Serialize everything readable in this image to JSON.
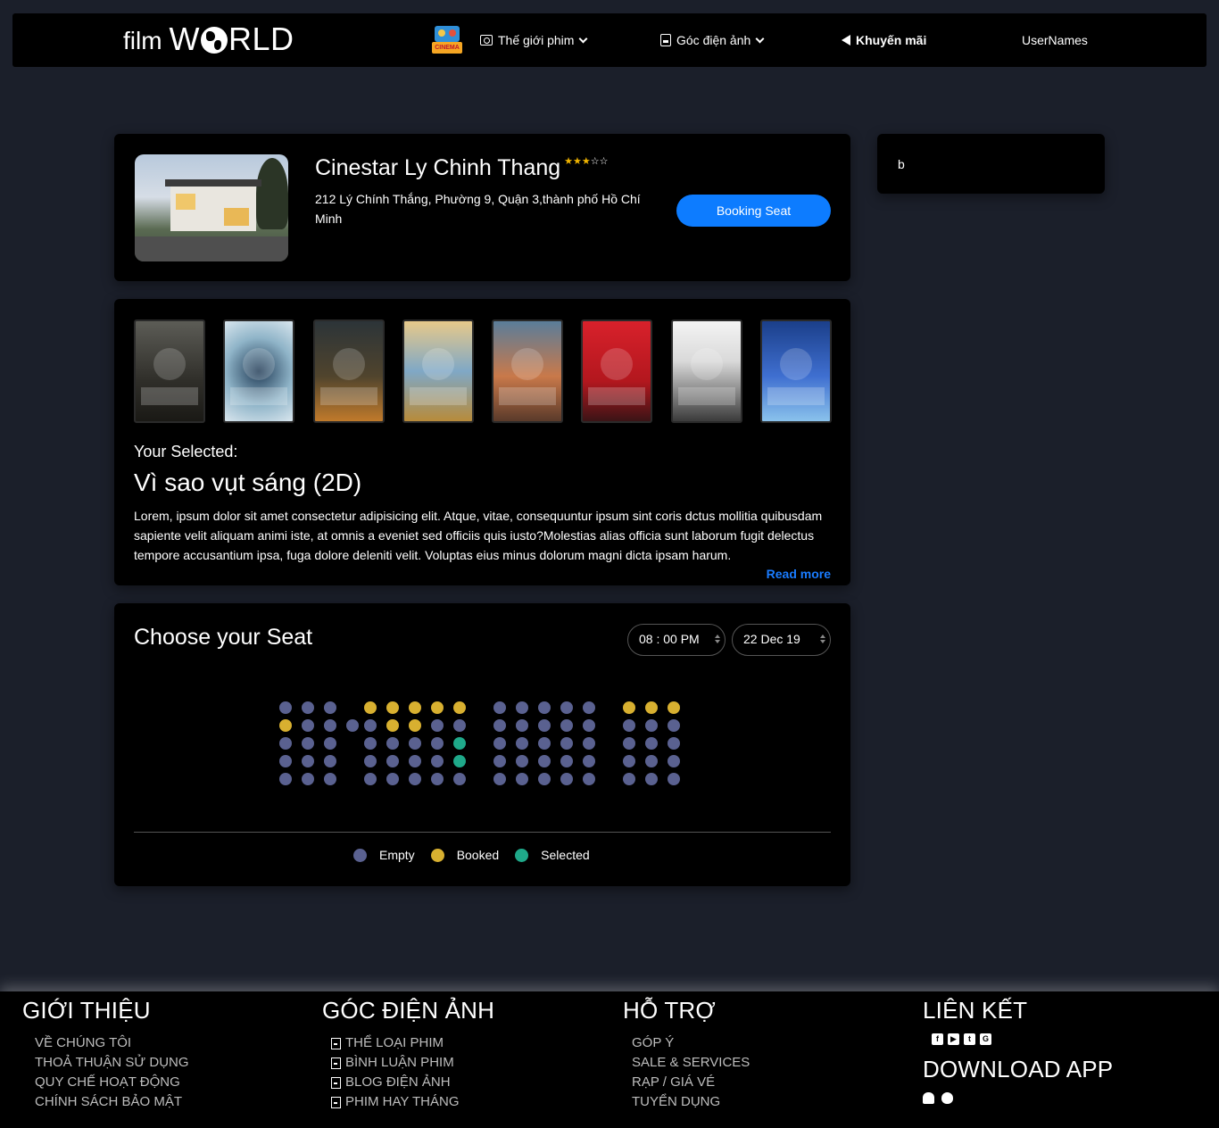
{
  "nav": {
    "logo_film": "film",
    "logo_world_start": "W",
    "logo_world_end": "RLD",
    "cinema_badge": "CINEMA",
    "items": [
      {
        "label": "Thế giới phim",
        "icon": "camera-icon",
        "dropdown": true
      },
      {
        "label": "Góc điện ảnh",
        "icon": "document-icon",
        "dropdown": true
      },
      {
        "label": "Khuyến mãi",
        "icon": "megaphone-icon",
        "dropdown": false
      }
    ],
    "user": "UserNames"
  },
  "cinema": {
    "name": "Cinestar Ly Chinh Thang",
    "rating": 3,
    "max_rating": 5,
    "address": "212 Lý Chính Thắng, Phường 9, Quận 3,thành phố Hồ Chí Minh",
    "booking_label": "Booking Seat"
  },
  "sidebar": {
    "text": "b"
  },
  "movies": {
    "selected_label": "Your Selected:",
    "selected_title": "Vì sao vụt sáng (2D)",
    "description": "Lorem, ipsum dolor sit amet consectetur adipisicing elit. Atque, vitae, consequuntur ipsum sint coris dctus mollitia quibusdam sapiente velit aliquam animi iste, at omnis a eveniet sed officiis quis iusto?Molestias alias officia sunt laborum fugit delectus tempore accusantium ipsa, fuga dolore deleniti velit. Voluptas eius minus dolorum magni dicta ipsam harum.",
    "read_more": "Read more"
  },
  "seats": {
    "title": "Choose your Seat",
    "time": "08 : 00 PM",
    "date": "22 Dec 19",
    "rows": [
      "eee bbbbb eeeee bbb",
      "beee ebbee eeeee eee",
      "eee eeees eeeee eee",
      "eee eeees eeeee eee",
      "eee eeeee eeeee eee"
    ],
    "legend": {
      "empty": "Empty",
      "booked": "Booked",
      "selected": "Selected"
    },
    "colors": {
      "empty": "#5a6190",
      "booked": "#d8b030",
      "selected": "#1fa98a"
    }
  },
  "footer": {
    "about": {
      "title": "GIỚI THIỆU",
      "links": [
        "VỀ CHÚNG TÔI",
        "THOẢ THUẬN SỬ DỤNG",
        "QUY CHẾ HOẠT ĐỘNG",
        "CHÍNH SÁCH BẢO MẬT"
      ]
    },
    "cinema_corner": {
      "title": "GÓC ĐIỆN ẢNH",
      "links": [
        "THỂ LOẠI PHIM",
        "BÌNH LUẬN PHIM",
        "BLOG ĐIỆN ẢNH",
        "PHIM HAY THÁNG"
      ]
    },
    "support": {
      "title": "HỖ TRỢ",
      "links": [
        "GÓP Ý",
        "SALE & SERVICES",
        "RẠP / GIÁ VÉ",
        "TUYỂN DỤNG"
      ]
    },
    "links": {
      "title": "LIÊN KẾT",
      "download_title": "DOWNLOAD APP"
    }
  }
}
